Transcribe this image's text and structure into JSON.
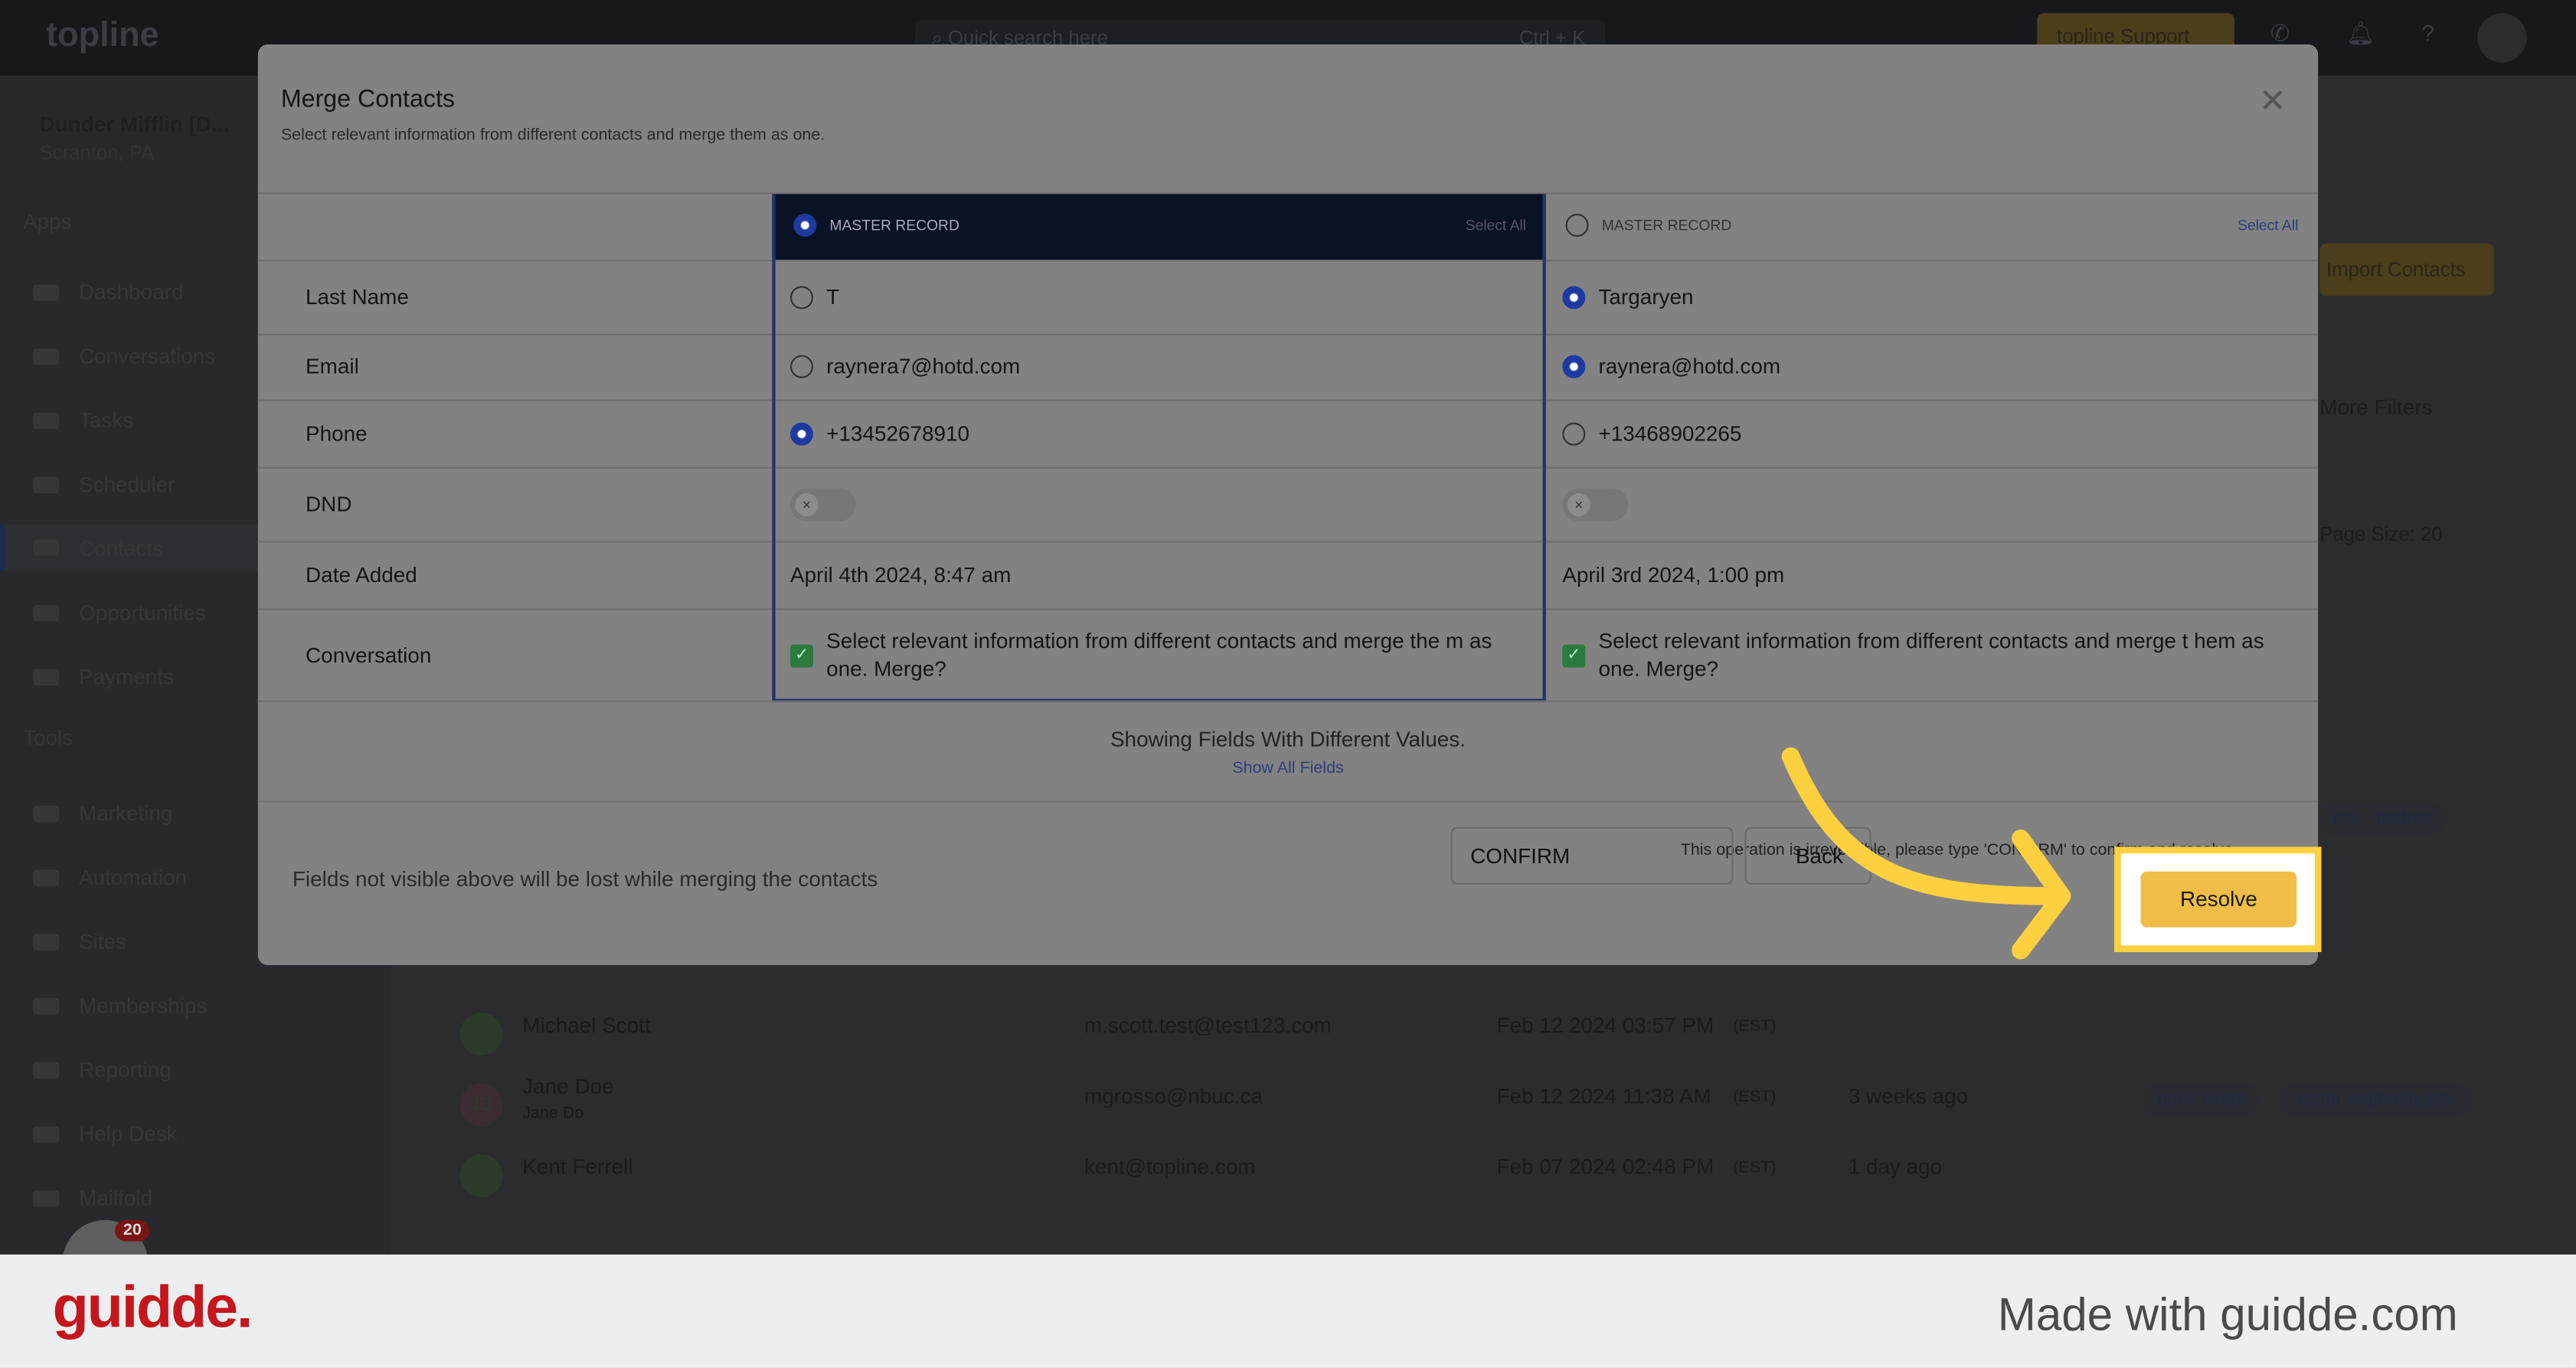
{
  "topbar": {
    "logo": "topline",
    "search_placeholder": "Quick search here",
    "search_shortcut": "Ctrl + K",
    "support_label": "topline Support"
  },
  "sidebar": {
    "org_name": "Dunder Mifflin [D...",
    "org_location": "Scranton, PA",
    "apps_heading": "Apps",
    "tools_heading": "Tools",
    "apps": [
      "Dashboard",
      "Conversations",
      "Tasks",
      "Scheduler",
      "Contacts",
      "Opportunities",
      "Payments"
    ],
    "tools": [
      "Marketing",
      "Automation",
      "Sites",
      "Memberships",
      "Reporting",
      "Help Desk",
      "Mailfold"
    ],
    "badge_count": "20",
    "active": "Contacts"
  },
  "background": {
    "import_label": "Import Contacts",
    "filters_label": "More Filters",
    "page_size": "Page Size: 20",
    "tag_partial": "ical - padres",
    "rows": [
      {
        "initials": "MS",
        "name": "Michael Scott",
        "sub": "",
        "email": "m.scott.test@test123.com",
        "date": "Feb 12 2024 03:57 PM",
        "tz": "(EST)",
        "activity": "",
        "tags": []
      },
      {
        "initials": "JD",
        "name": "Jane Doe",
        "sub": "Jane Do",
        "email": "mgrosso@nbuc.ca",
        "date": "Feb 12 2024 11:38 AM",
        "tz": "(EST)",
        "activity": "3 weeks ago",
        "tags": [
          "book event",
          "doctor-nephrologists"
        ]
      },
      {
        "initials": "KF",
        "name": "Kent Ferrell",
        "sub": "",
        "email": "kent@topline.com",
        "date": "Feb 07 2024 02:48 PM",
        "tz": "(EST)",
        "activity": "1 day ago",
        "tags": []
      }
    ]
  },
  "modal": {
    "title": "Merge Contacts",
    "subtitle": "Select relevant information from different contacts and merge them as one.",
    "col1": {
      "header": "MASTER RECORD",
      "select_all": "Select All",
      "selected": true
    },
    "col2": {
      "header": "MASTER RECORD",
      "select_all": "Select All",
      "selected": false
    },
    "fields": [
      {
        "label": "Last Name",
        "v1": "T",
        "v2": "Targaryen",
        "pick": 2
      },
      {
        "label": "Email",
        "v1": "raynera7@hotd.com",
        "v2": "raynera@hotd.com",
        "pick": 2
      },
      {
        "label": "Phone",
        "v1": "+13452678910",
        "v2": "+13468902265",
        "pick": 1
      },
      {
        "label": "DND",
        "v1_on": false,
        "v2_on": false
      },
      {
        "label": "Date Added",
        "v1": "April 4th 2024, 8:47 am",
        "v2": "April 3rd 2024, 1:00 pm"
      },
      {
        "label": "Conversation",
        "v1": "Select relevant information from different contacts and merge the m as one. Merge?",
        "v2": "Select relevant information from different contacts and merge t hem as one. Merge?",
        "checked1": true,
        "checked2": true
      }
    ],
    "showing": "Showing Fields With Different Values.",
    "show_all": "Show All Fields",
    "warning": "Fields not visible above will be lost while merging the contacts",
    "irreversible": "This operation is irreversible, please type 'CONFIRM' to confirm and resolve.",
    "confirm_value": "CONFIRM",
    "back_label": "Back",
    "resolve_label": "Resolve"
  },
  "colors": {
    "accent": "#efbd48",
    "highlight": "#fdd040",
    "master_header": "#0a1226",
    "radio": "#1e3aa0"
  },
  "footer": {
    "brand": "guidde.",
    "made_with": "Made with guidde.com"
  }
}
